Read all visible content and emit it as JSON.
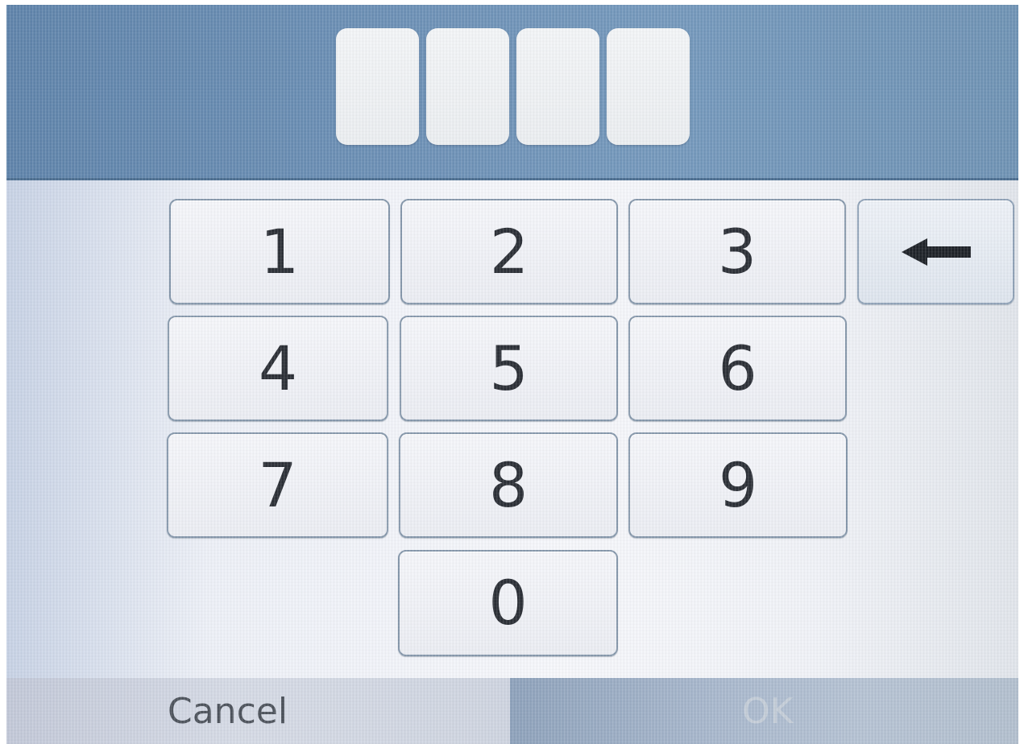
{
  "pin_entry": {
    "slots": [
      "",
      "",
      "",
      ""
    ]
  },
  "keypad": {
    "keys": [
      "1",
      "2",
      "3",
      "4",
      "5",
      "6",
      "7",
      "8",
      "9",
      "0"
    ],
    "backspace_icon": "left-arrow-icon"
  },
  "footer": {
    "cancel_label": "Cancel",
    "ok_label": "OK"
  },
  "colors": {
    "header": "#6d91b7",
    "key_face": "#f3f4f8",
    "key_border": "#8698ac",
    "key_text": "#2b2f36",
    "ok_disabled_text": "#c5ced9"
  }
}
